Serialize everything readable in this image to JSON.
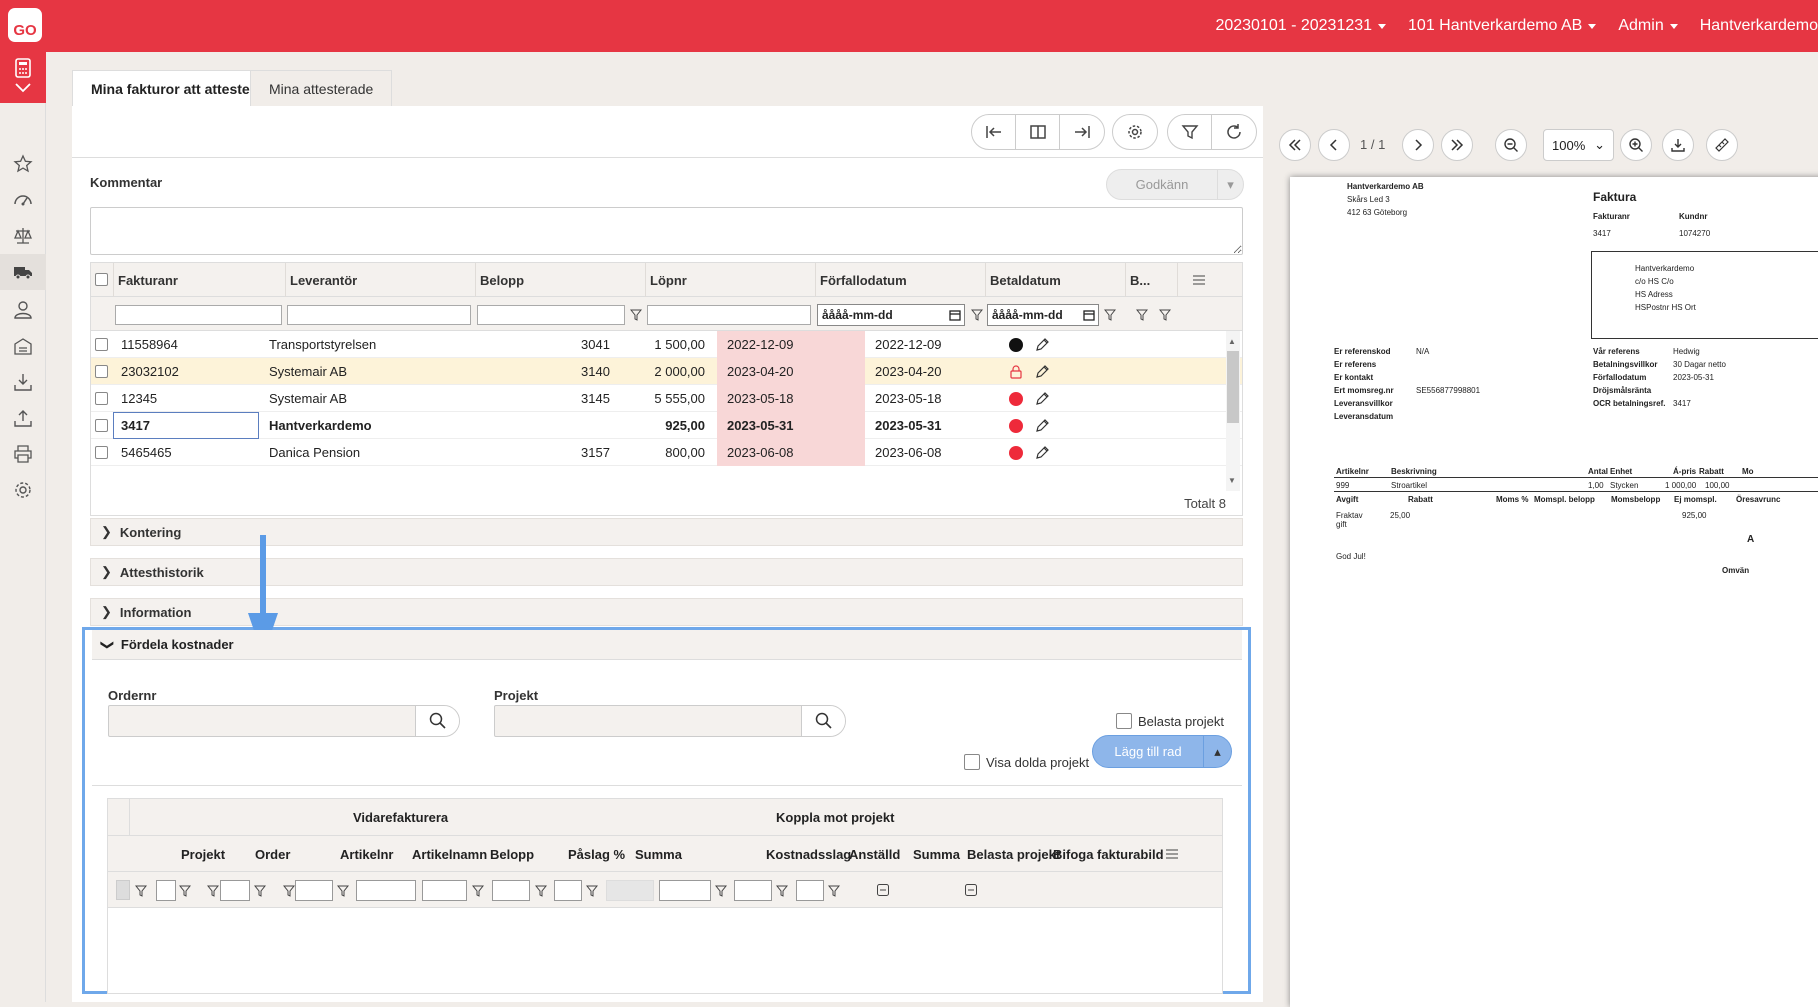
{
  "header": {
    "logo": "GO",
    "period": "20230101 - 20231231",
    "company": "101 Hantverkardemo AB",
    "user": "Admin",
    "company_short": "Hantverkardemo"
  },
  "sidebar": {
    "icons": [
      "calculator-icon",
      "star-icon",
      "dashboard-icon",
      "scale-icon",
      "truck-icon",
      "person-icon",
      "warehouse-icon",
      "download-icon",
      "upload-icon",
      "printer-icon",
      "gear-icon"
    ]
  },
  "tabs": [
    {
      "label": "Mina fakturor att attestera",
      "active": true
    },
    {
      "label": "Mina attesterade",
      "active": false
    }
  ],
  "comment": {
    "label": "Kommentar",
    "approve_label": "Godkänn"
  },
  "grid": {
    "columns": [
      "Fakturanr",
      "Leverantör",
      "Belopp",
      "Löpnr",
      "Förfallodatum",
      "Betaldatum",
      "B..."
    ],
    "date_placeholder": "åååå-mm-dd",
    "rows": [
      {
        "fakturanr": "11558964",
        "leverantor": "Transportstyrelsen",
        "belopp": "1 500,00",
        "lopnr": "3041",
        "forfallo": "2022-12-09",
        "betal": "2022-12-09",
        "status": "dot-black",
        "bold": false,
        "highlight": false
      },
      {
        "fakturanr": "23032102",
        "leverantor": "Systemair AB",
        "belopp": "2 000,00",
        "lopnr": "3140",
        "forfallo": "2023-04-20",
        "betal": "2023-04-20",
        "status": "lock-icon",
        "bold": false,
        "highlight": true
      },
      {
        "fakturanr": "12345",
        "leverantor": "Systemair AB",
        "belopp": "5 555,00",
        "lopnr": "3145",
        "forfallo": "2023-05-18",
        "betal": "2023-05-18",
        "status": "dot-red",
        "bold": false,
        "highlight": false
      },
      {
        "fakturanr": "3417",
        "leverantor": "Hantverkardemo",
        "belopp": "925,00",
        "lopnr": "",
        "forfallo": "2023-05-31",
        "betal": "2023-05-31",
        "status": "dot-red",
        "bold": true,
        "highlight": false
      },
      {
        "fakturanr": "5465465",
        "leverantor": "Danica Pension",
        "belopp": "800,00",
        "lopnr": "3157",
        "forfallo": "2023-06-08",
        "betal": "2023-06-08",
        "status": "dot-red",
        "bold": false,
        "highlight": false
      }
    ],
    "total": "Totalt 8"
  },
  "sections": [
    "Kontering",
    "Attesthistorik",
    "Information"
  ],
  "fordela": {
    "title": "Fördela kostnader",
    "ordernr_label": "Ordernr",
    "projekt_label": "Projekt",
    "belasta_label": "Belasta projekt",
    "visa_dolda_label": "Visa dolda projekt",
    "add_row_label": "Lägg till rad",
    "group_headers": [
      "Vidarefakturera",
      "Koppla mot projekt"
    ],
    "columns": [
      "Projekt",
      "Order",
      "Artikelnr",
      "Artikelnamn",
      "Belopp",
      "Påslag %",
      "Summa",
      "Kostnadsslag",
      "Anställd",
      "Summa",
      "Belasta projekt",
      "Bifoga fakturabild"
    ]
  },
  "viewer": {
    "page": "1 / 1",
    "zoom": "100%",
    "invoice": {
      "sender_name": "Hantverkardemo AB",
      "sender_street": "Skårs Led 3",
      "sender_city": "412 63 Göteborg",
      "title": "Faktura",
      "fakturanr_label": "Fakturanr",
      "kundnr_label": "Kundnr",
      "fakturanr": "3417",
      "kundnr": "1074270",
      "recipient": [
        "Hantverkardemo",
        "c/o HS C/o",
        "HS Adress",
        "HSPostnr HS Ort"
      ],
      "left_labels": [
        "Er referenskod",
        "Er referens",
        "Er kontakt",
        "Ert momsreg.nr",
        "Leveransvillkor",
        "Leveransdatum"
      ],
      "left_values": [
        "N/A",
        "",
        "",
        "SE556877998801",
        "",
        ""
      ],
      "right_labels": [
        "Vår referens",
        "Betalningsvillkor",
        "Förfallodatum",
        "Dröjsmålsränta",
        "OCR betalningsref."
      ],
      "right_values": [
        "Hedwig",
        "30 Dagar netto",
        "2023-05-31",
        "",
        "3417"
      ],
      "item_headers": [
        "Artikelnr",
        "Beskrivning",
        "Antal",
        "Enhet",
        "Á-pris",
        "Rabatt",
        "Mo"
      ],
      "item_row": [
        "999",
        "Stroartikel",
        "1,00",
        "Stycken",
        "1 000,00",
        "100,00"
      ],
      "fee_headers": [
        "Avgift",
        "Rabatt",
        "Moms %",
        "Momspl. belopp",
        "Momsbelopp",
        "Ej momspl.",
        "Öresavrunc"
      ],
      "fee_label": "Fraktav gift",
      "fee_value": "25,00",
      "fee_amount": "925,00",
      "footer_text": "God Jul!",
      "right_a": "A",
      "omvand": "Omvän"
    }
  }
}
